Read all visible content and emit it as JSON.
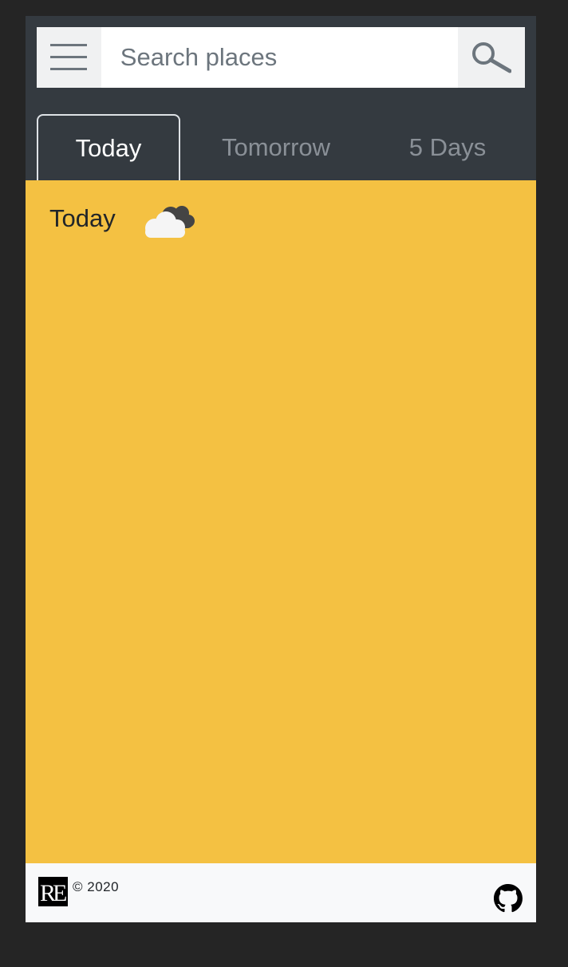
{
  "search": {
    "placeholder": "Search places",
    "value": ""
  },
  "tabs": [
    {
      "label": "Today",
      "active": true
    },
    {
      "label": "Tomorrow",
      "active": false
    },
    {
      "label": "5 Days",
      "active": false
    }
  ],
  "content": {
    "title": "Today",
    "weather_icon": "cloudy-icon"
  },
  "footer": {
    "logo_text": "RE",
    "copyright": "© 2020",
    "github_icon": "github-icon"
  },
  "colors": {
    "page_background": "#252525",
    "navbar": "#343a40",
    "content_background": "#f4c142",
    "footer_background": "#f8f9fa",
    "active_tab_text": "#ffffff",
    "inactive_tab_text": "#8a9097"
  }
}
